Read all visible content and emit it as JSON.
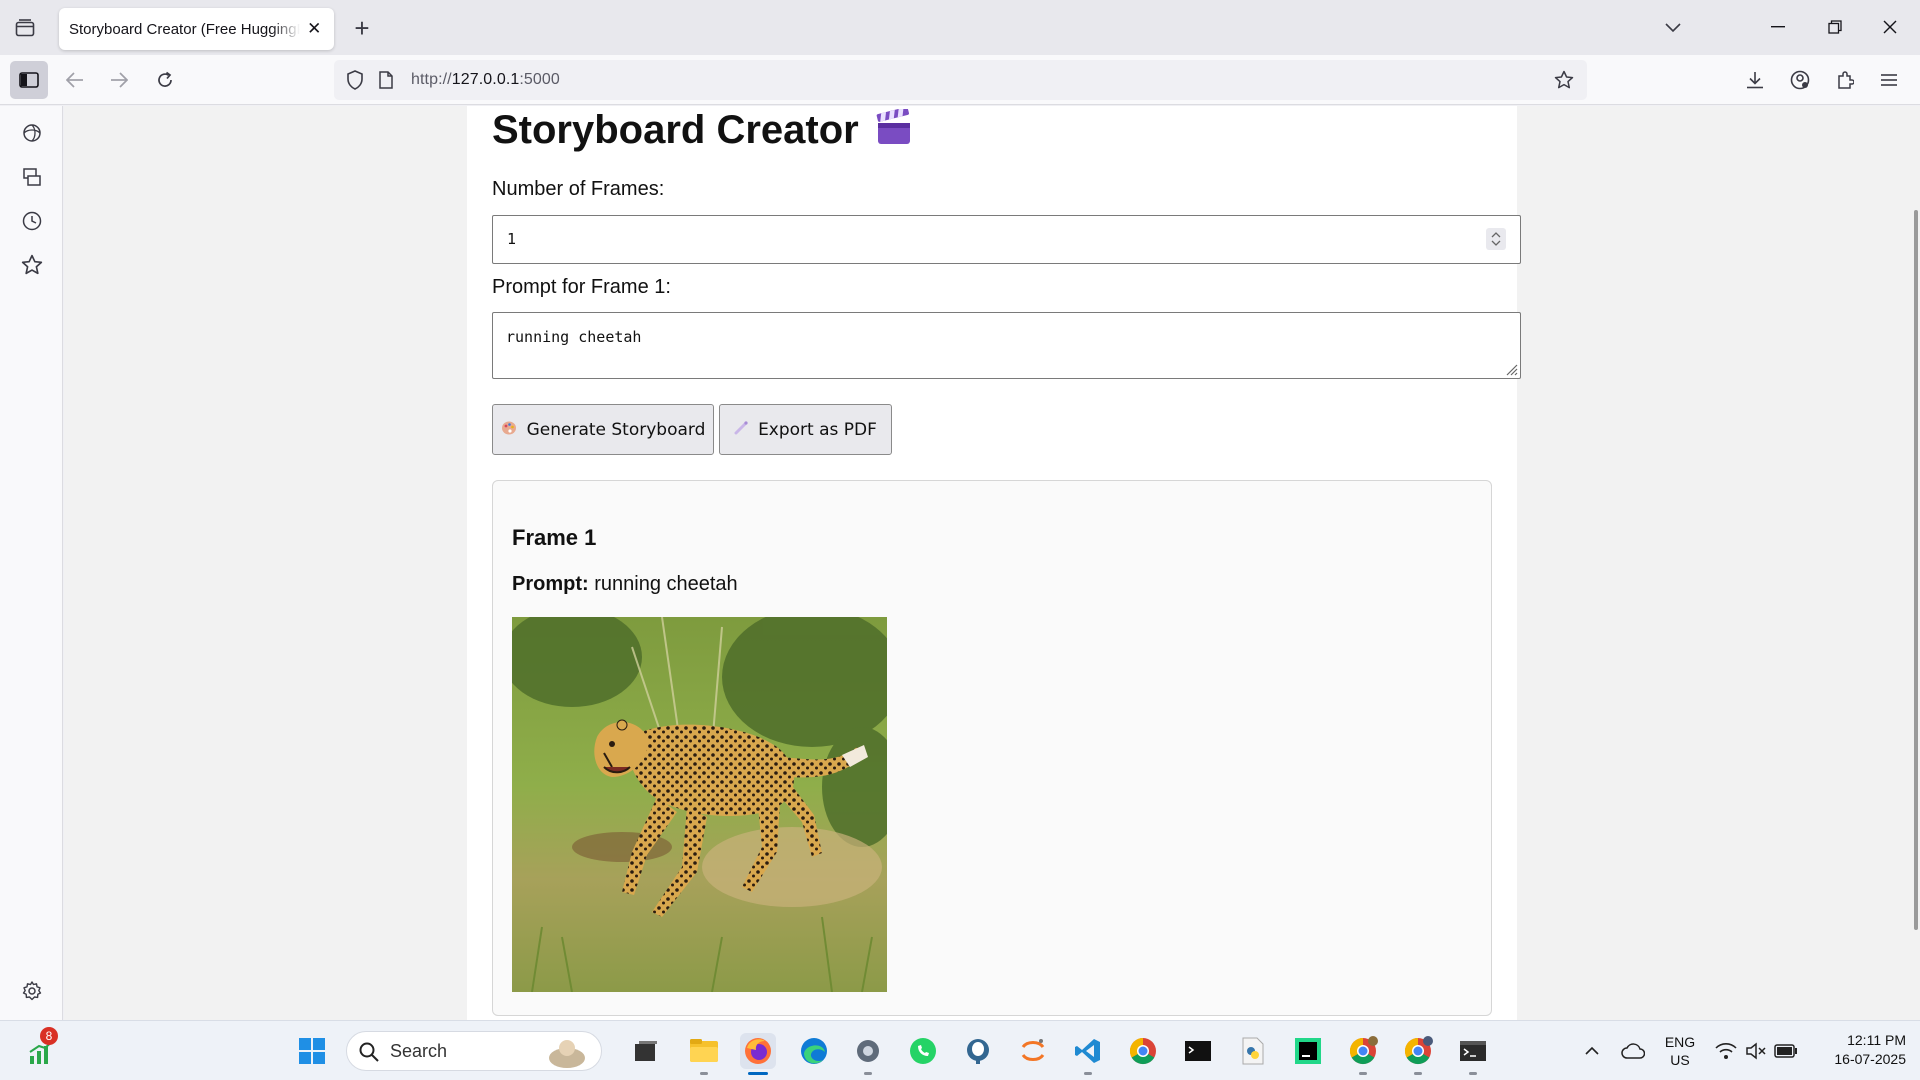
{
  "browser": {
    "tab_title": "Storyboard Creator (Free HuggingFace",
    "tab_close": "✕",
    "new_tab": "+",
    "url_scheme": "http://",
    "url_host": "127.0.0.1",
    "url_port": ":5000",
    "accent": "#cfcfd8"
  },
  "page": {
    "title": "Storyboard Creator",
    "frames_label": "Number of Frames:",
    "frames_value": "1",
    "prompt_label": "Prompt for Frame 1:",
    "prompt_value": "running cheetah",
    "generate_button": "Generate Storyboard",
    "export_button": "Export as PDF"
  },
  "frames": [
    {
      "title": "Frame 1",
      "prompt_label": "Prompt:",
      "prompt_text": "running cheetah",
      "image_subject": "cheetah running on grass"
    }
  ],
  "taskbar": {
    "search_placeholder": "Search",
    "notification_badge": "8",
    "language_line1": "ENG",
    "language_line2": "US",
    "time": "12:11 PM",
    "date": "16-07-2025"
  }
}
